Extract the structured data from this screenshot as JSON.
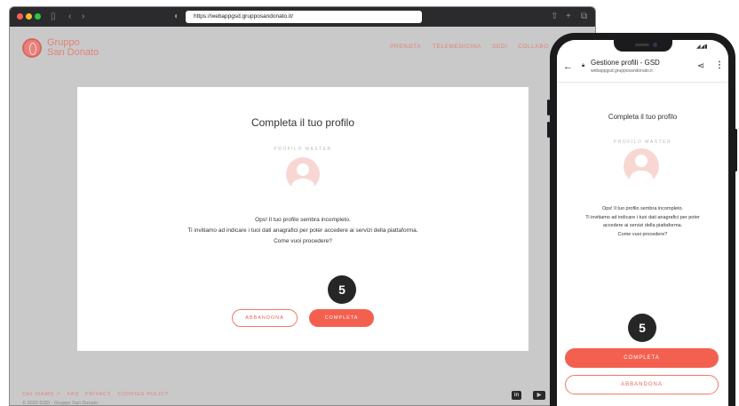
{
  "desktop": {
    "url": "https://webappgsd.grupposandonato.it/",
    "brand": {
      "line1": "Gruppo",
      "line2": "San Donato"
    },
    "nav": [
      "PRENOTA",
      "TELEMEDICINA",
      "SEDI",
      "COLLABO"
    ],
    "card": {
      "title": "Completa il tuo profilo",
      "profile_label": "PROFILO MASTER",
      "message": [
        "Ops! Il tuo profilo sembra incompleto.",
        "Ti invitiamo ad indicare i tuoi dati anagrafici per poter accedere ai servizi della piattaforma.",
        "Come vuoi procedere?"
      ],
      "step_badge": "5",
      "abbandona_label": "ABBANDONA",
      "completa_label": "COMPLETA"
    },
    "footer": {
      "links": [
        "CHI SIAMO ↗",
        "FAQ",
        "PRIVACY",
        "COOKIES POLICY"
      ],
      "copyright": "© 2022 GSD - Gruppo San Donato",
      "social": [
        "in",
        "▶"
      ]
    }
  },
  "mobile": {
    "page_title": "Gestione profili - GSD",
    "url": "webappgsd.grupposandonato.it",
    "card": {
      "title": "Completa il tuo profilo",
      "profile_label": "PROFILO MASTER",
      "message": [
        "Ops! Il tuo profilo sembra incompleto.",
        "Ti invitiamo ad indicare i tuoi dati anagrafici per poter",
        "accedere ai servizi della piattaforma.",
        "Come vuoi procedere?"
      ],
      "step_badge": "5",
      "completa_label": "COMPLETA",
      "abbandona_label": "ABBANDONA"
    }
  },
  "colors": {
    "accent": "#f4604f",
    "brand": "#e38278",
    "overlay": "#c9c9c9"
  }
}
